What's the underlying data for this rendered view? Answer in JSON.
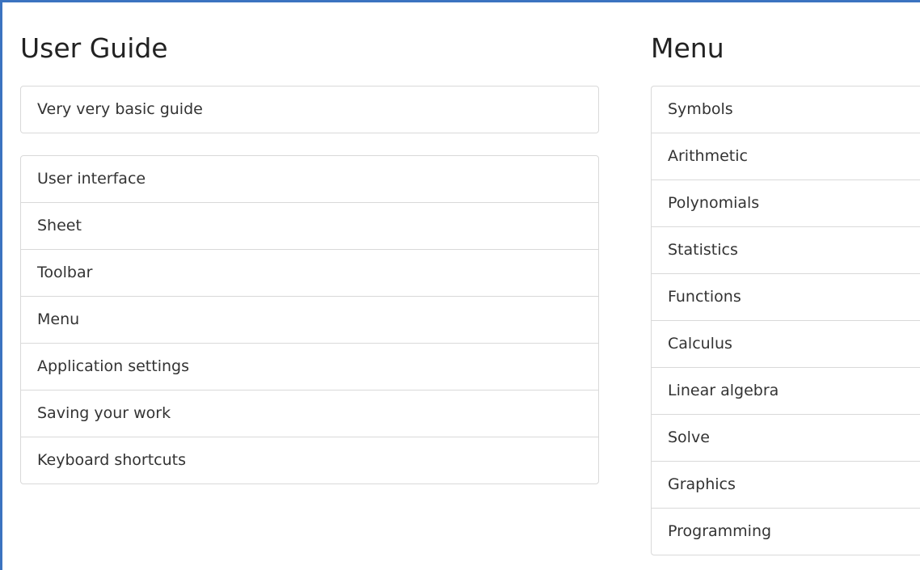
{
  "user_guide": {
    "title": "User Guide",
    "basic_items": [
      {
        "label": "Very very basic guide"
      }
    ],
    "items": [
      {
        "label": "User interface"
      },
      {
        "label": "Sheet"
      },
      {
        "label": "Toolbar"
      },
      {
        "label": "Menu"
      },
      {
        "label": "Application settings"
      },
      {
        "label": "Saving your work"
      },
      {
        "label": "Keyboard shortcuts"
      }
    ]
  },
  "menu": {
    "title": "Menu",
    "items": [
      {
        "label": "Symbols"
      },
      {
        "label": "Arithmetic"
      },
      {
        "label": "Polynomials"
      },
      {
        "label": "Statistics"
      },
      {
        "label": "Functions"
      },
      {
        "label": "Calculus"
      },
      {
        "label": "Linear algebra"
      },
      {
        "label": "Solve"
      },
      {
        "label": "Graphics"
      },
      {
        "label": "Programming"
      }
    ]
  },
  "colors": {
    "frame_accent": "#3b73c0",
    "border": "#d9d9d9",
    "text": "#333333"
  }
}
